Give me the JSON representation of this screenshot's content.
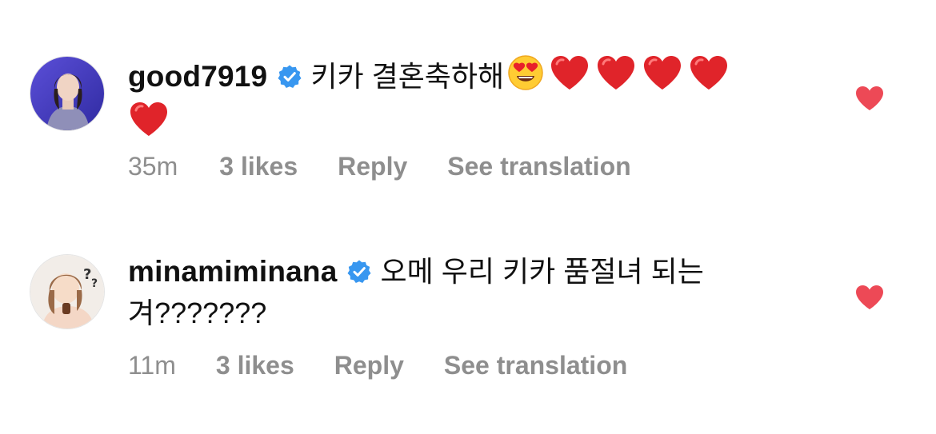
{
  "comments": [
    {
      "username": "good7919",
      "text": "키카 결혼축하해",
      "emojis": [
        "smiling-face-heart-eyes",
        "red-heart",
        "red-heart",
        "red-heart",
        "red-heart",
        "red-heart"
      ],
      "time": "35m",
      "likes": "3 likes",
      "reply": "Reply",
      "translation": "See translation"
    },
    {
      "username": "minamiminana",
      "text": "오메 우리 키카 품절녀 되는 겨???????",
      "time": "11m",
      "likes": "3 likes",
      "reply": "Reply",
      "translation": "See translation"
    }
  ],
  "icons": {
    "verified": "verified-badge-icon",
    "like": "heart-icon"
  },
  "colors": {
    "verified": "#3897f0",
    "like": "#ed4956",
    "meta": "#8e8e8e",
    "text": "#111111"
  }
}
